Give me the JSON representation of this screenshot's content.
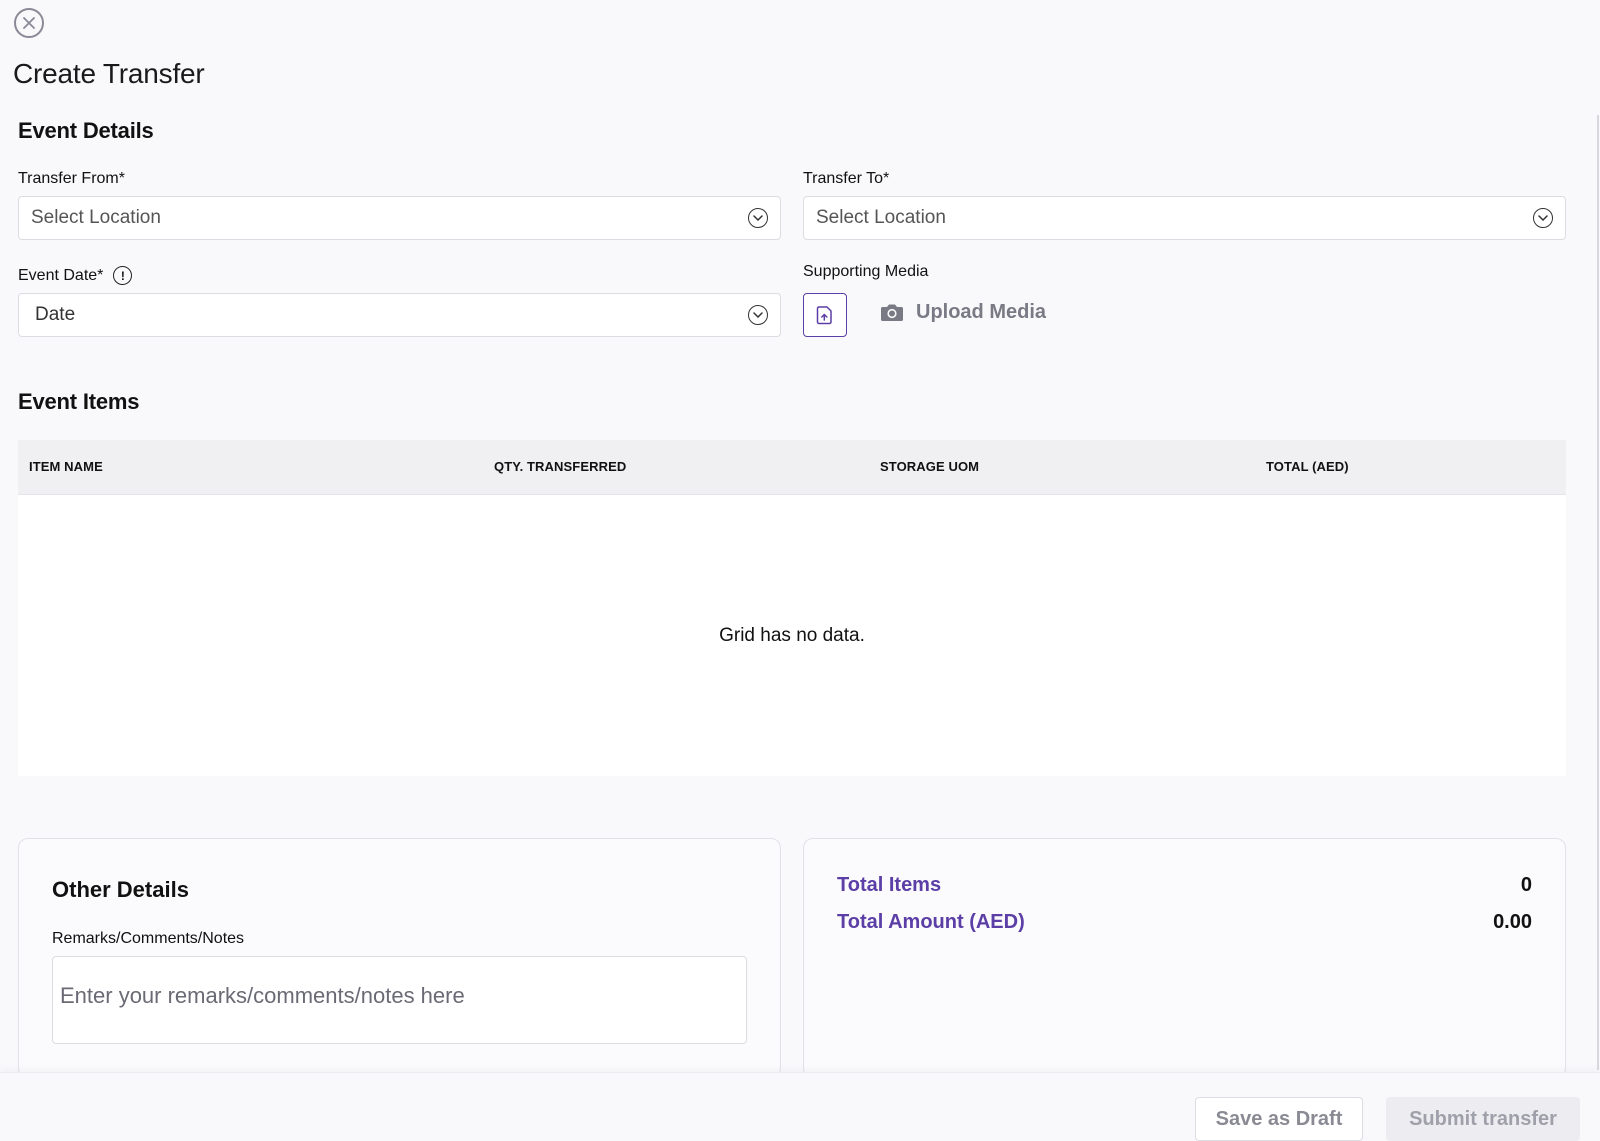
{
  "page": {
    "title": "Create Transfer"
  },
  "event_details": {
    "title": "Event Details",
    "transfer_from": {
      "label": "Transfer From*",
      "value": "Select Location"
    },
    "transfer_to": {
      "label": "Transfer To*",
      "value": "Select Location"
    },
    "event_date": {
      "label": "Event Date*",
      "value": "Date"
    },
    "supporting_media": {
      "label": "Supporting Media",
      "upload_label": "Upload Media"
    }
  },
  "event_items": {
    "title": "Event Items",
    "columns": [
      "ITEM NAME",
      "QTY. TRANSFERRED",
      "STORAGE UOM",
      "TOTAL (AED)"
    ],
    "empty_message": "Grid has no data."
  },
  "other_details": {
    "title": "Other Details",
    "remarks_label": "Remarks/Comments/Notes",
    "remarks_placeholder": "Enter your remarks/comments/notes here"
  },
  "summary": {
    "total_items_label": "Total Items",
    "total_items_value": "0",
    "total_amount_label": "Total Amount (AED)",
    "total_amount_value": "0.00"
  },
  "footer": {
    "save_draft_label": "Save as Draft",
    "submit_label": "Submit transfer"
  },
  "colors": {
    "accent": "#5b3ea6",
    "background": "#f9f9fc"
  },
  "icons": {
    "close": "close-icon",
    "chevron": "chevron-down-icon",
    "info": "info-icon",
    "upload": "file-upload-icon",
    "camera": "camera-icon"
  }
}
